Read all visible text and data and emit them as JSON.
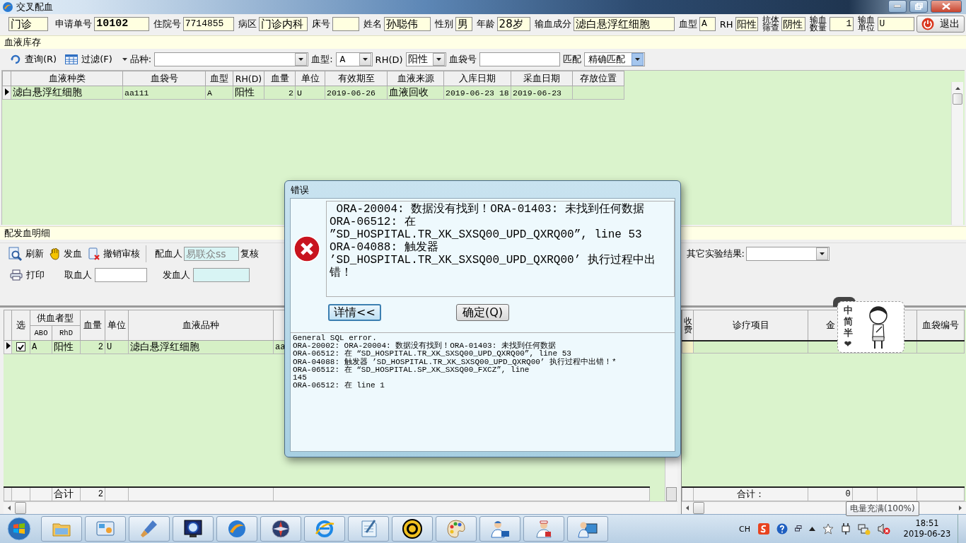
{
  "window": {
    "title": "交叉配血"
  },
  "patient": {
    "visit_type": "门诊",
    "fields": [
      {
        "label": "申请单号",
        "value": "10102"
      },
      {
        "label": "住院号",
        "value": "7714855"
      },
      {
        "label": "病区",
        "value": "门诊内科"
      },
      {
        "label": "床号"
      },
      {
        "label": "姓名",
        "value": "孙聪伟"
      },
      {
        "label": "性别",
        "value": "男"
      },
      {
        "label": "年龄",
        "value": "28岁"
      },
      {
        "label": "输血成分",
        "value": "滤白悬浮红细胞"
      },
      {
        "label": "血型",
        "value": "A"
      },
      {
        "label": "RH",
        "value": "阳性"
      },
      {
        "label": "抗体筛查",
        "value": "阴性"
      },
      {
        "label": "输血数量",
        "value": "1"
      },
      {
        "label": "输血单位",
        "value": "U"
      }
    ],
    "exit_button": "退出"
  },
  "inventory": {
    "title": "血液库存",
    "toolbar": {
      "query": "查询(R)",
      "filter": "过滤(F)",
      "variety_label": "品种:",
      "blood_type_label": "血型:",
      "blood_type": "A",
      "rh_label": "RH(D)",
      "rh": "阳性",
      "bag_no_label": "血袋号",
      "match_label": "匹配",
      "match": "精确匹配"
    },
    "columns": [
      "血液种类",
      "血袋号",
      "血型",
      "RH(D)",
      "血量",
      "单位",
      "有效期至",
      "血液来源",
      "入库日期",
      "采血日期",
      "存放位置"
    ],
    "rows": [
      {
        "selected": true,
        "cells": [
          "滤白悬浮红细胞",
          "aa111",
          "A",
          "阳性",
          "2",
          "U",
          "2019-06-26",
          "血液回收",
          "2019-06-23 18",
          "2019-06-23"
        ]
      }
    ]
  },
  "detail": {
    "title": "配发血明细",
    "toolbar": {
      "refresh": "刷新",
      "issue": "发血",
      "cancel_review": "撤销审核",
      "matcher_label": "配血人",
      "matcher": "易联众ss",
      "matcher_disabled": true,
      "reviewer_label": "复核",
      "other_results_label": "其它实验结果:",
      "print": "打印",
      "taker_label": "取血人",
      "taker_disabled": false,
      "issuer_label": "发血人",
      "issuer_disabled": true
    },
    "grid": {
      "select_header": "选",
      "group_header": "供血者型",
      "columns": [
        "ABO",
        "RhD",
        "血量",
        "单位",
        "血液品种"
      ],
      "rows": [
        {
          "selected": true,
          "checked": true,
          "cells": [
            "A",
            "阳性",
            "2",
            "U",
            "滤白悬浮红细胞",
            "aa"
          ]
        }
      ],
      "totals": {
        "label": "合计",
        "amount": "2"
      }
    },
    "fee_grid": {
      "columns": [
        {
          "label": "收费"
        },
        {
          "label": "诊疗项目"
        },
        {
          "label": "金"
        },
        {},
        {},
        {
          "label": "血袋编号"
        }
      ],
      "totals": {
        "label": "合计：",
        "amount": "0"
      }
    }
  },
  "dialog": {
    "title": "错误",
    "message": " ORA-20004: 数据没有找到！ORA-01403: 未找到任何数据\nORA-06512: 在\n”SD_HOSPITAL.TR_XK_SXSQ00_UPD_QXRQ00”, line 53\nORA-04088: 触发器\n’SD_HOSPITAL.TR_XK_SXSQ00_UPD_QXRQ00’ 执行过程中出错！",
    "buttons": [
      {
        "label": "详情<<",
        "focused": true
      },
      {
        "label": "确定(Q)",
        "focused": false
      }
    ],
    "details": "General SQL error.\nORA-20002: ORA-20004: 数据没有找到！ORA-01403: 未找到任何数据\nORA-06512: 在 “SD_HOSPITAL.TR_XK_SXSQ00_UPD_QXRQ00”, line 53\nORA-04088: 触发器 ’SD_HOSPITAL.TR_XK_SXSQ00_UPD_QXRQ00’ 执行过程中出错！*\nORA-06512: 在 “SD_HOSPITAL.SP_XK_SXSQ00_FXCZ”, line\n145\nORA-06512: 在 line 1"
  },
  "ime_widget": {
    "labels": [
      "中",
      "简",
      "半",
      "❤"
    ]
  },
  "tooltip": "电量充满(100%)",
  "taskbar": {
    "language": "CH",
    "time": "18:51",
    "date": "2019-06-23"
  }
}
